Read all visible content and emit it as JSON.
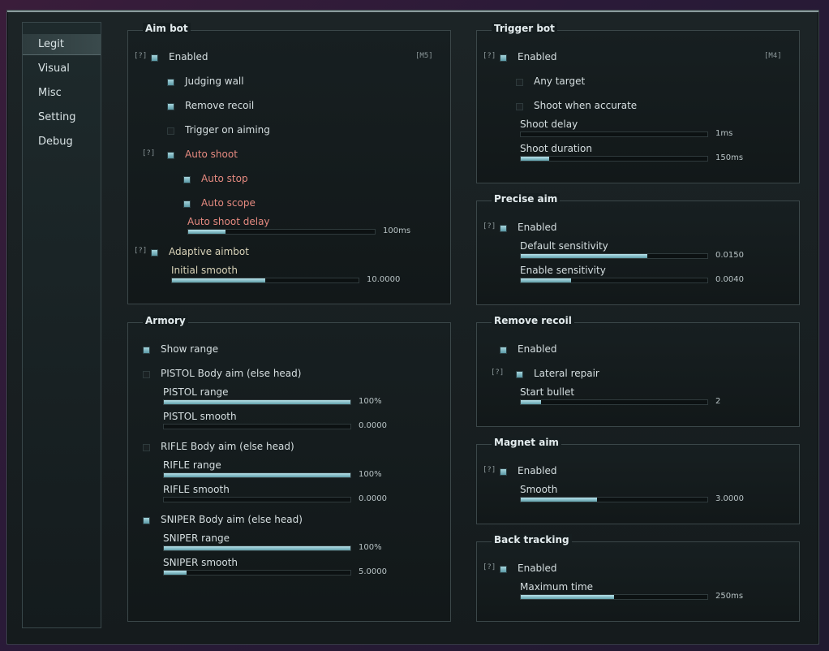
{
  "nav": [
    "Legit",
    "Visual",
    "Misc",
    "Setting",
    "Debug"
  ],
  "aimbot": {
    "title": "Aim bot",
    "help": "[?]",
    "enabled": "Enabled",
    "key": "[M5]",
    "judging_wall": "Judging wall",
    "remove_recoil": "Remove recoil",
    "trigger_on_aiming": "Trigger on aiming",
    "auto_shoot": "Auto shoot",
    "auto_stop": "Auto stop",
    "auto_scope": "Auto scope",
    "auto_shoot_delay": "Auto shoot delay",
    "auto_shoot_delay_value": "100ms",
    "auto_shoot_delay_fraction": 0.2,
    "adaptive_aimbot": "Adaptive aimbot",
    "initial_smooth": "Initial smooth",
    "initial_smooth_value": "10.0000",
    "initial_smooth_fraction": 0.5
  },
  "armory": {
    "title": "Armory",
    "show_range": "Show range",
    "pistol_body": "PISTOL Body aim (else head)",
    "pistol_range": "PISTOL range",
    "pistol_range_value": "100%",
    "pistol_range_fraction": 1.0,
    "pistol_smooth": "PISTOL smooth",
    "pistol_smooth_value": "0.0000",
    "pistol_smooth_fraction": 0.0,
    "rifle_body": "RIFLE Body aim (else head)",
    "rifle_range": "RIFLE range",
    "rifle_range_value": "100%",
    "rifle_range_fraction": 1.0,
    "rifle_smooth": "RIFLE smooth",
    "rifle_smooth_value": "0.0000",
    "rifle_smooth_fraction": 0.0,
    "sniper_body": "SNIPER Body aim (else head)",
    "sniper_range": "SNIPER range",
    "sniper_range_value": "100%",
    "sniper_range_fraction": 1.0,
    "sniper_smooth": "SNIPER smooth",
    "sniper_smooth_value": "5.0000",
    "sniper_smooth_fraction": 0.12
  },
  "triggerbot": {
    "title": "Trigger bot",
    "help": "[?]",
    "enabled": "Enabled",
    "key": "[M4]",
    "any_target": "Any target",
    "shoot_when_accurate": "Shoot when accurate",
    "shoot_delay": "Shoot delay",
    "shoot_delay_value": "1ms",
    "shoot_delay_fraction": 0.0,
    "shoot_duration": "Shoot duration",
    "shoot_duration_value": "150ms",
    "shoot_duration_fraction": 0.15
  },
  "precise": {
    "title": "Precise aim",
    "help": "[?]",
    "enabled": "Enabled",
    "default_sens": "Default sensitivity",
    "default_sens_value": "0.0150",
    "default_sens_fraction": 0.68,
    "enable_sens": "Enable sensitivity",
    "enable_sens_value": "0.0040",
    "enable_sens_fraction": 0.27
  },
  "recoil": {
    "title": "Remove recoil",
    "help": "[?]",
    "enabled": "Enabled",
    "lateral_repair": "Lateral repair",
    "start_bullet": "Start bullet",
    "start_bullet_value": "2",
    "start_bullet_fraction": 0.11
  },
  "magnet": {
    "title": "Magnet aim",
    "help": "[?]",
    "enabled": "Enabled",
    "smooth": "Smooth",
    "smooth_value": "3.0000",
    "smooth_fraction": 0.41
  },
  "backtrack": {
    "title": "Back tracking",
    "help": "[?]",
    "enabled": "Enabled",
    "max_time": "Maximum time",
    "max_time_value": "250ms",
    "max_time_fraction": 0.5
  }
}
